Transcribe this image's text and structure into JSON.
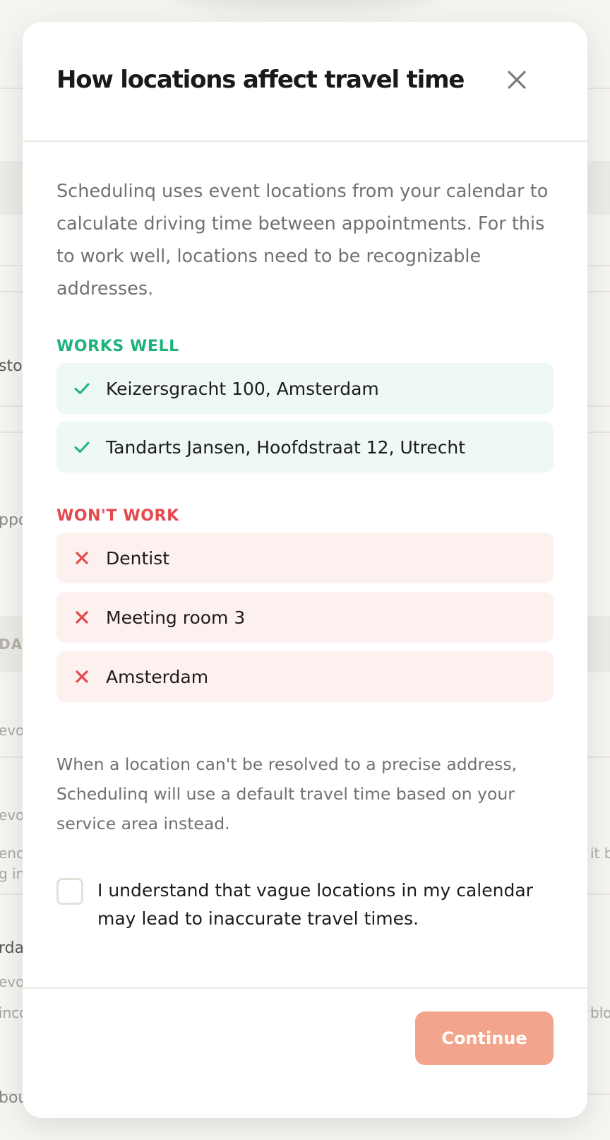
{
  "background": {
    "fragments": [
      "stor",
      "ppo",
      "DAI",
      "evoo",
      "evoo",
      "encl",
      "g in",
      "rda",
      "evoo",
      "inco",
      "bou",
      "it b",
      "blo"
    ]
  },
  "modal": {
    "title": "How locations affect travel time",
    "intro": "Schedulinq uses event locations from your calendar to calculate driving time between appointments. For this to work well, locations need to be recognizable addresses.",
    "works_well": {
      "heading": "WORKS WELL",
      "color": "#1fb37c",
      "icon": "check-icon",
      "items": [
        "Keizersgracht 100, Amsterdam",
        "Tandarts Jansen, Hoofdstraat 12, Utrecht"
      ]
    },
    "wont_work": {
      "heading": "WON'T WORK",
      "color": "#e5484d",
      "icon": "cross-icon",
      "items": [
        "Dentist",
        "Meeting room 3",
        "Amsterdam"
      ]
    },
    "note": "When a location can't be resolved to a precise address, Schedulinq will use a default travel time based on your service area instead.",
    "consent": {
      "label": "I understand that vague locations in my calendar may lead to inaccurate travel times.",
      "checked": false
    },
    "footer": {
      "continue_label": "Continue",
      "continue_color": "#f2a58c",
      "continue_enabled": false
    },
    "close_icon": "close-icon"
  }
}
